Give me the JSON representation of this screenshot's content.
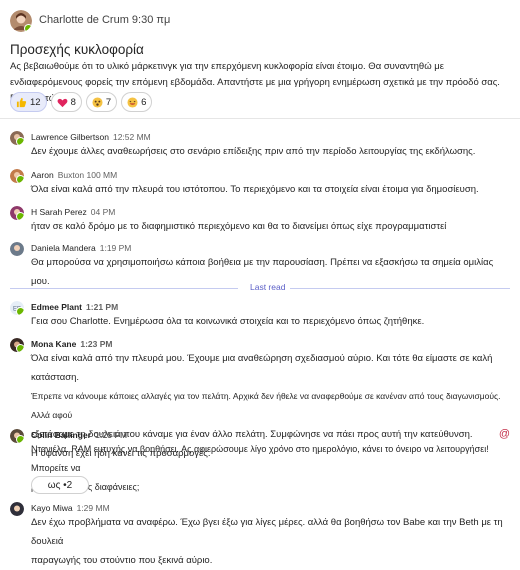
{
  "post": {
    "author": "Charlotte de Crum 9:30 πμ",
    "title": "Προσεχής κυκλοφορία",
    "body": "Ας βεβαιωθούμε ότι το υλικό μάρκετινγκ για την επερχόμενη κυκλοφορία είναι έτοιμο. Θα συναντηθώ με ενδιαφερόμενους φορείς την επόμενη εβδομάδα. Απαντήστε με μια γρήγορη ενημέρωση σχετικά με την πρόοδό σας. Ευχαριστώ!",
    "reactions": [
      {
        "icon": "thumbs-up-icon",
        "count": "12"
      },
      {
        "icon": "heart-icon",
        "count": "8"
      },
      {
        "icon": "surprised-face-icon",
        "count": "7"
      },
      {
        "icon": "laugh-face-icon",
        "count": "6"
      }
    ]
  },
  "messages": [
    {
      "author": "Lawrence Gilbertson",
      "time": "12:52 MM",
      "text": [
        "Δεν έχουμε άλλες αναθεωρήσεις στο σενάριο επίδειξης πριν από την περίοδο λειτουργίας της εκδήλωσης."
      ]
    },
    {
      "author": "Aaron",
      "time": "Buxton 100 MM",
      "text": [
        "Όλα είναι καλά από την πλευρά του ιστότοπου. Το περιεχόμενο και τα στοιχεία είναι έτοιμα για δημοσίευση."
      ]
    },
    {
      "author": "H Sarah Perez",
      "time": "04 PM",
      "text": [
        "ήταν σε καλό δρόμο με το διαφημιστικό περιεχόμενο και θα το διανείμει όπως είχε προγραμματιστεί"
      ]
    },
    {
      "author": "Daniela Mandera",
      "time": "1:19 PM",
      "text": [
        "Θα μπορούσα να χρησιμοποιήσω κάποια βοήθεια με την παρουσίαση. Πρέπει να εξασκήσω τα σημεία ομιλίας μου."
      ]
    },
    {
      "author": "Edmee Plant",
      "time": "1:21 PM",
      "text": [
        "Γεια σου Charlotte. Ενημέρωσα όλα τα κοινωνικά στοιχεία και το περιεχόμενο όπως ζητήθηκε."
      ]
    },
    {
      "author": "Mona Kane",
      "time": "1:23 PM",
      "text": [
        "Όλα είναι καλά από την πλευρά μου. Έχουμε μια αναθεώρηση σχεδιασμού αύριο. Και τότε θα είμαστε σε καλή κατάσταση.",
        "Έπρεπε να κάνουμε κάποιες αλλαγές για τον πελάτη. Αρχικά δεν ήθελε να αναφερθούμε σε κανέναν από τους διαγωνισμούς. Αλλά αφού",
        "εξετάσαμε τη δουλειά που κάναμε για έναν άλλο πελάτη. Συμφώνησε να πάει προς αυτή την κατεύθυνση.",
        "Η ύφανση έχει ήδη κάνει τις προσαρμογές."
      ]
    },
    {
      "author": "Colin Ballinger",
      "time": "1:25 PM",
      "text": [
        "Ντανιέλα. RAM ευτυχής να βοηθήσει. Ας αφιερώσουμε λίγο χρόνο στο ημερολόγιο, κάνει το όνειρο να λειτουργήσει! Μπορείτε να",
        "μου στείλετε τις διαφάνειες;"
      ]
    },
    {
      "author": "Kayo Miwa",
      "time": "1:29 MM",
      "text": [
        "Δεν έχω προβλήματα να αναφέρω. Έχω βγει έξω για λίγες μέρες. αλλά θα βοηθήσω τον Babe και την Beth με τη δουλειά",
        "παραγωγής του στούντιο που ξεκινά αύριο."
      ]
    }
  ],
  "divider_label": "Last read",
  "mention_symbol": "@",
  "reply_chip": "ως •2",
  "colors": {
    "accent": "#5b5fc7",
    "presence": "#6bb700",
    "mention": "#c4314b"
  }
}
